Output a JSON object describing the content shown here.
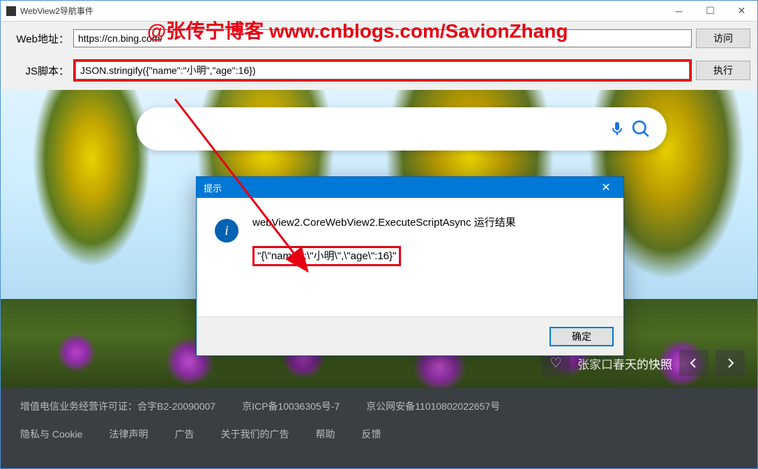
{
  "window": {
    "title": "WebView2导航事件",
    "minimize": "─",
    "maximize": "☐",
    "close": "✕"
  },
  "watermark": "@张传宁博客 www.cnblogs.com/SavionZhang",
  "form": {
    "url_label": "Web地址：",
    "url_value": "https://cn.bing.com/",
    "url_button": "访问",
    "js_label": "JS脚本：",
    "js_value": "JSON.stringify({\"name\":\"小明\",\"age\":16})",
    "js_button": "执行"
  },
  "bing": {
    "search_placeholder": "",
    "caption": "张家口春天的快照"
  },
  "footer": {
    "row1": [
      "增值电信业务经营许可证：合字B2-20090007",
      "京ICP备10036305号-7",
      "京公网安备11010802022657号"
    ],
    "row2": [
      "隐私与 Cookie",
      "法律声明",
      "广告",
      "关于我们的广告",
      "帮助",
      "反馈"
    ]
  },
  "dialog": {
    "title": "提示",
    "close": "✕",
    "heading": "webView2.CoreWebView2.ExecuteScriptAsync 运行结果",
    "result": "\"{\\\"name\\\":\\\"小明\\\",\\\"age\\\":16}\"",
    "ok": "确定"
  }
}
